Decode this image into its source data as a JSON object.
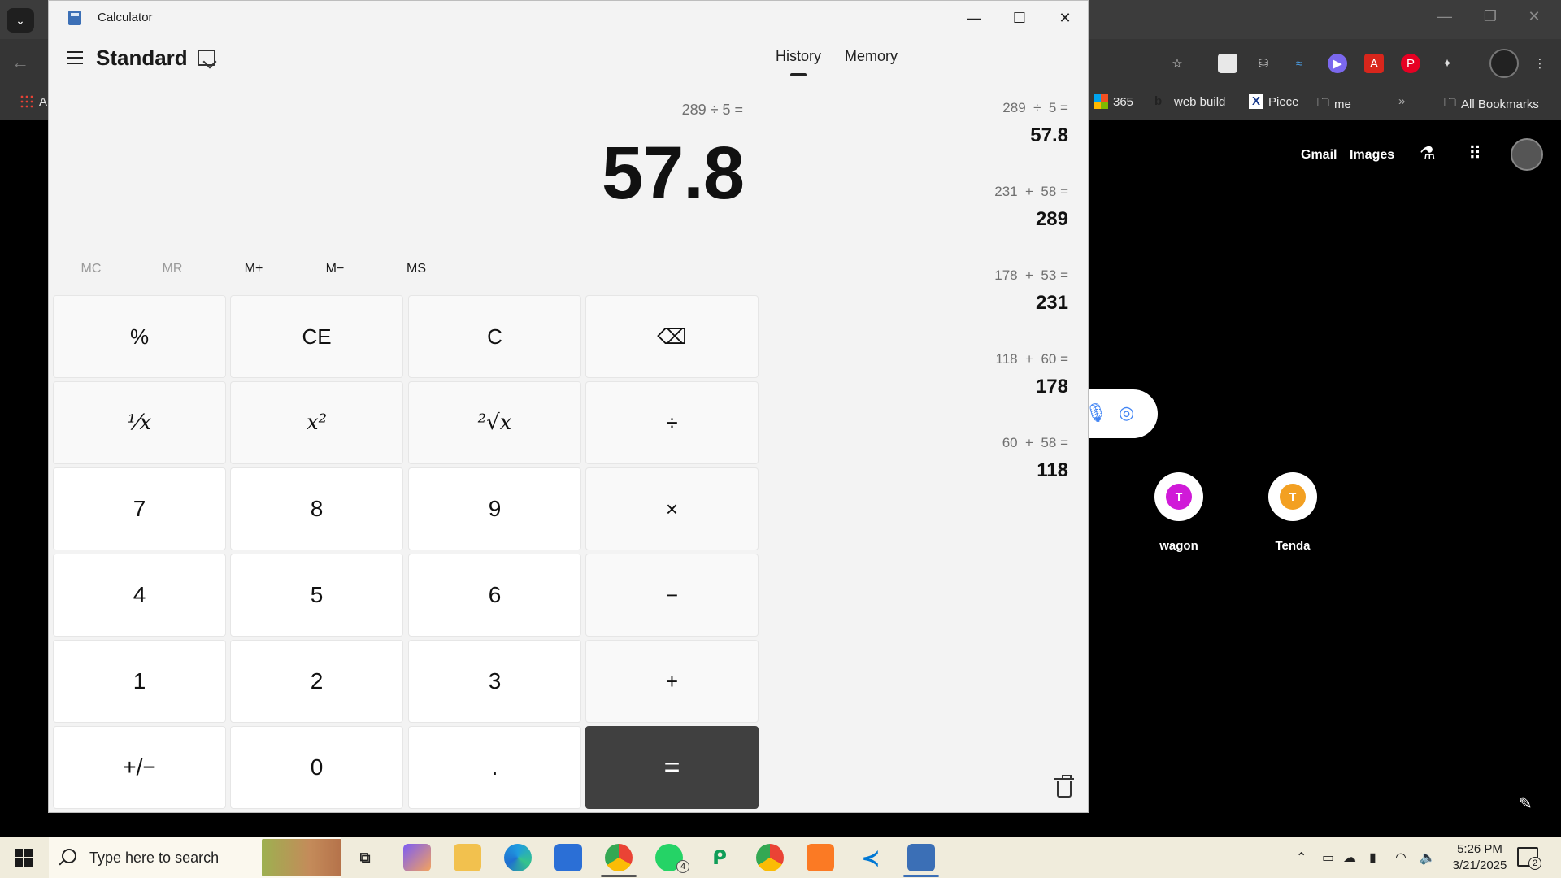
{
  "browser": {
    "bookmarks": [
      {
        "name": "apps",
        "label": "A"
      },
      {
        "name": "365",
        "label": "365"
      },
      {
        "name": "web-build",
        "label": "web build"
      },
      {
        "name": "piece",
        "label": "Piece"
      },
      {
        "name": "me",
        "label": "me"
      },
      {
        "name": "more",
        "label": "»"
      },
      {
        "name": "all-bookmarks",
        "label": "All Bookmarks"
      }
    ],
    "ntp_links": {
      "gmail": "Gmail",
      "images": "Images"
    },
    "shortcuts": [
      {
        "label": "wagon",
        "initial": "T",
        "color": "#d01ad8"
      },
      {
        "label": "Tenda",
        "initial": "T",
        "color": "#f3a022"
      }
    ]
  },
  "calculator": {
    "window_title": "Calculator",
    "mode": "Standard",
    "expression": "289 ÷ 5 =",
    "result": "57.8",
    "memory_buttons": [
      {
        "label": "MC",
        "enabled": false
      },
      {
        "label": "MR",
        "enabled": false
      },
      {
        "label": "M+",
        "enabled": true
      },
      {
        "label": "M−",
        "enabled": true
      },
      {
        "label": "MS",
        "enabled": true
      }
    ],
    "keys": {
      "percent": "%",
      "ce": "CE",
      "c": "C",
      "backspace": "⌫",
      "reciprocal": "⅟x",
      "square": "x²",
      "sqrt": "²√x",
      "divide": "÷",
      "seven": "7",
      "eight": "8",
      "nine": "9",
      "multiply": "×",
      "four": "4",
      "five": "5",
      "six": "6",
      "minus": "−",
      "one": "1",
      "two": "2",
      "three": "3",
      "plus": "+",
      "negate": "+/−",
      "zero": "0",
      "decimal": ".",
      "equals": "="
    },
    "tabs": {
      "history": "History",
      "memory": "Memory"
    },
    "history": [
      {
        "expr": "289  ÷  5 =",
        "result": "57.8"
      },
      {
        "expr": "231  +  58 =",
        "result": "289"
      },
      {
        "expr": "178  +  53 =",
        "result": "231"
      },
      {
        "expr": "118  +  60 =",
        "result": "178"
      },
      {
        "expr": "60  +  58 =",
        "result": "118"
      }
    ]
  },
  "taskbar": {
    "search_placeholder": "Type here to search",
    "time": "5:26 PM",
    "date": "3/21/2025",
    "whatsapp_badge": "4",
    "notification_count": "2"
  }
}
